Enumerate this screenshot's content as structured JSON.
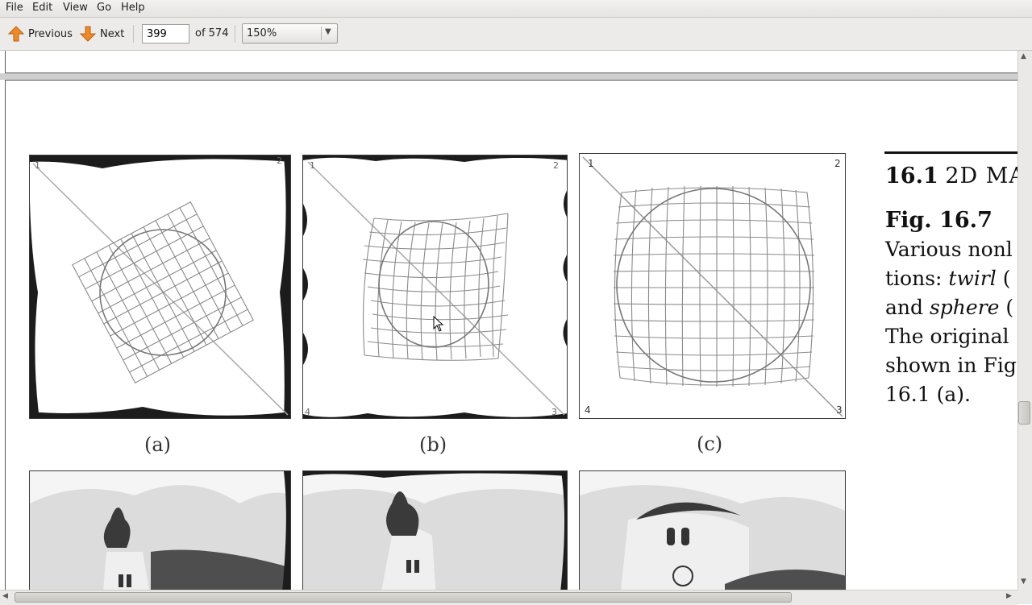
{
  "menubar": {
    "items": [
      "File",
      "Edit",
      "View",
      "Go",
      "Help"
    ]
  },
  "toolbar": {
    "previous_label": "Previous",
    "next_label": "Next",
    "page_number": "399",
    "page_total": "of 574",
    "zoom": "150%"
  },
  "figure": {
    "captions": [
      "(a)",
      "(b)",
      "(c)"
    ],
    "corner_numbers": [
      "1",
      "2",
      "3",
      "4"
    ]
  },
  "sidebar_text": {
    "section_number": "16.1",
    "section_title": "2D MA",
    "fig_label": "Fig. 16.7",
    "lines": [
      [
        "Various nonl",
        ""
      ],
      [
        "tions: ",
        "twirl",
        " ("
      ],
      [
        "and ",
        "sphere",
        " ("
      ],
      [
        "The original",
        ""
      ],
      [
        "shown in Fig",
        ""
      ],
      [
        "16.1 (a).",
        ""
      ]
    ]
  },
  "colors": {
    "arrow_orange": "#e9862c",
    "panel_border": "#3a3a3a",
    "grid_line": "#8a8a8a"
  }
}
